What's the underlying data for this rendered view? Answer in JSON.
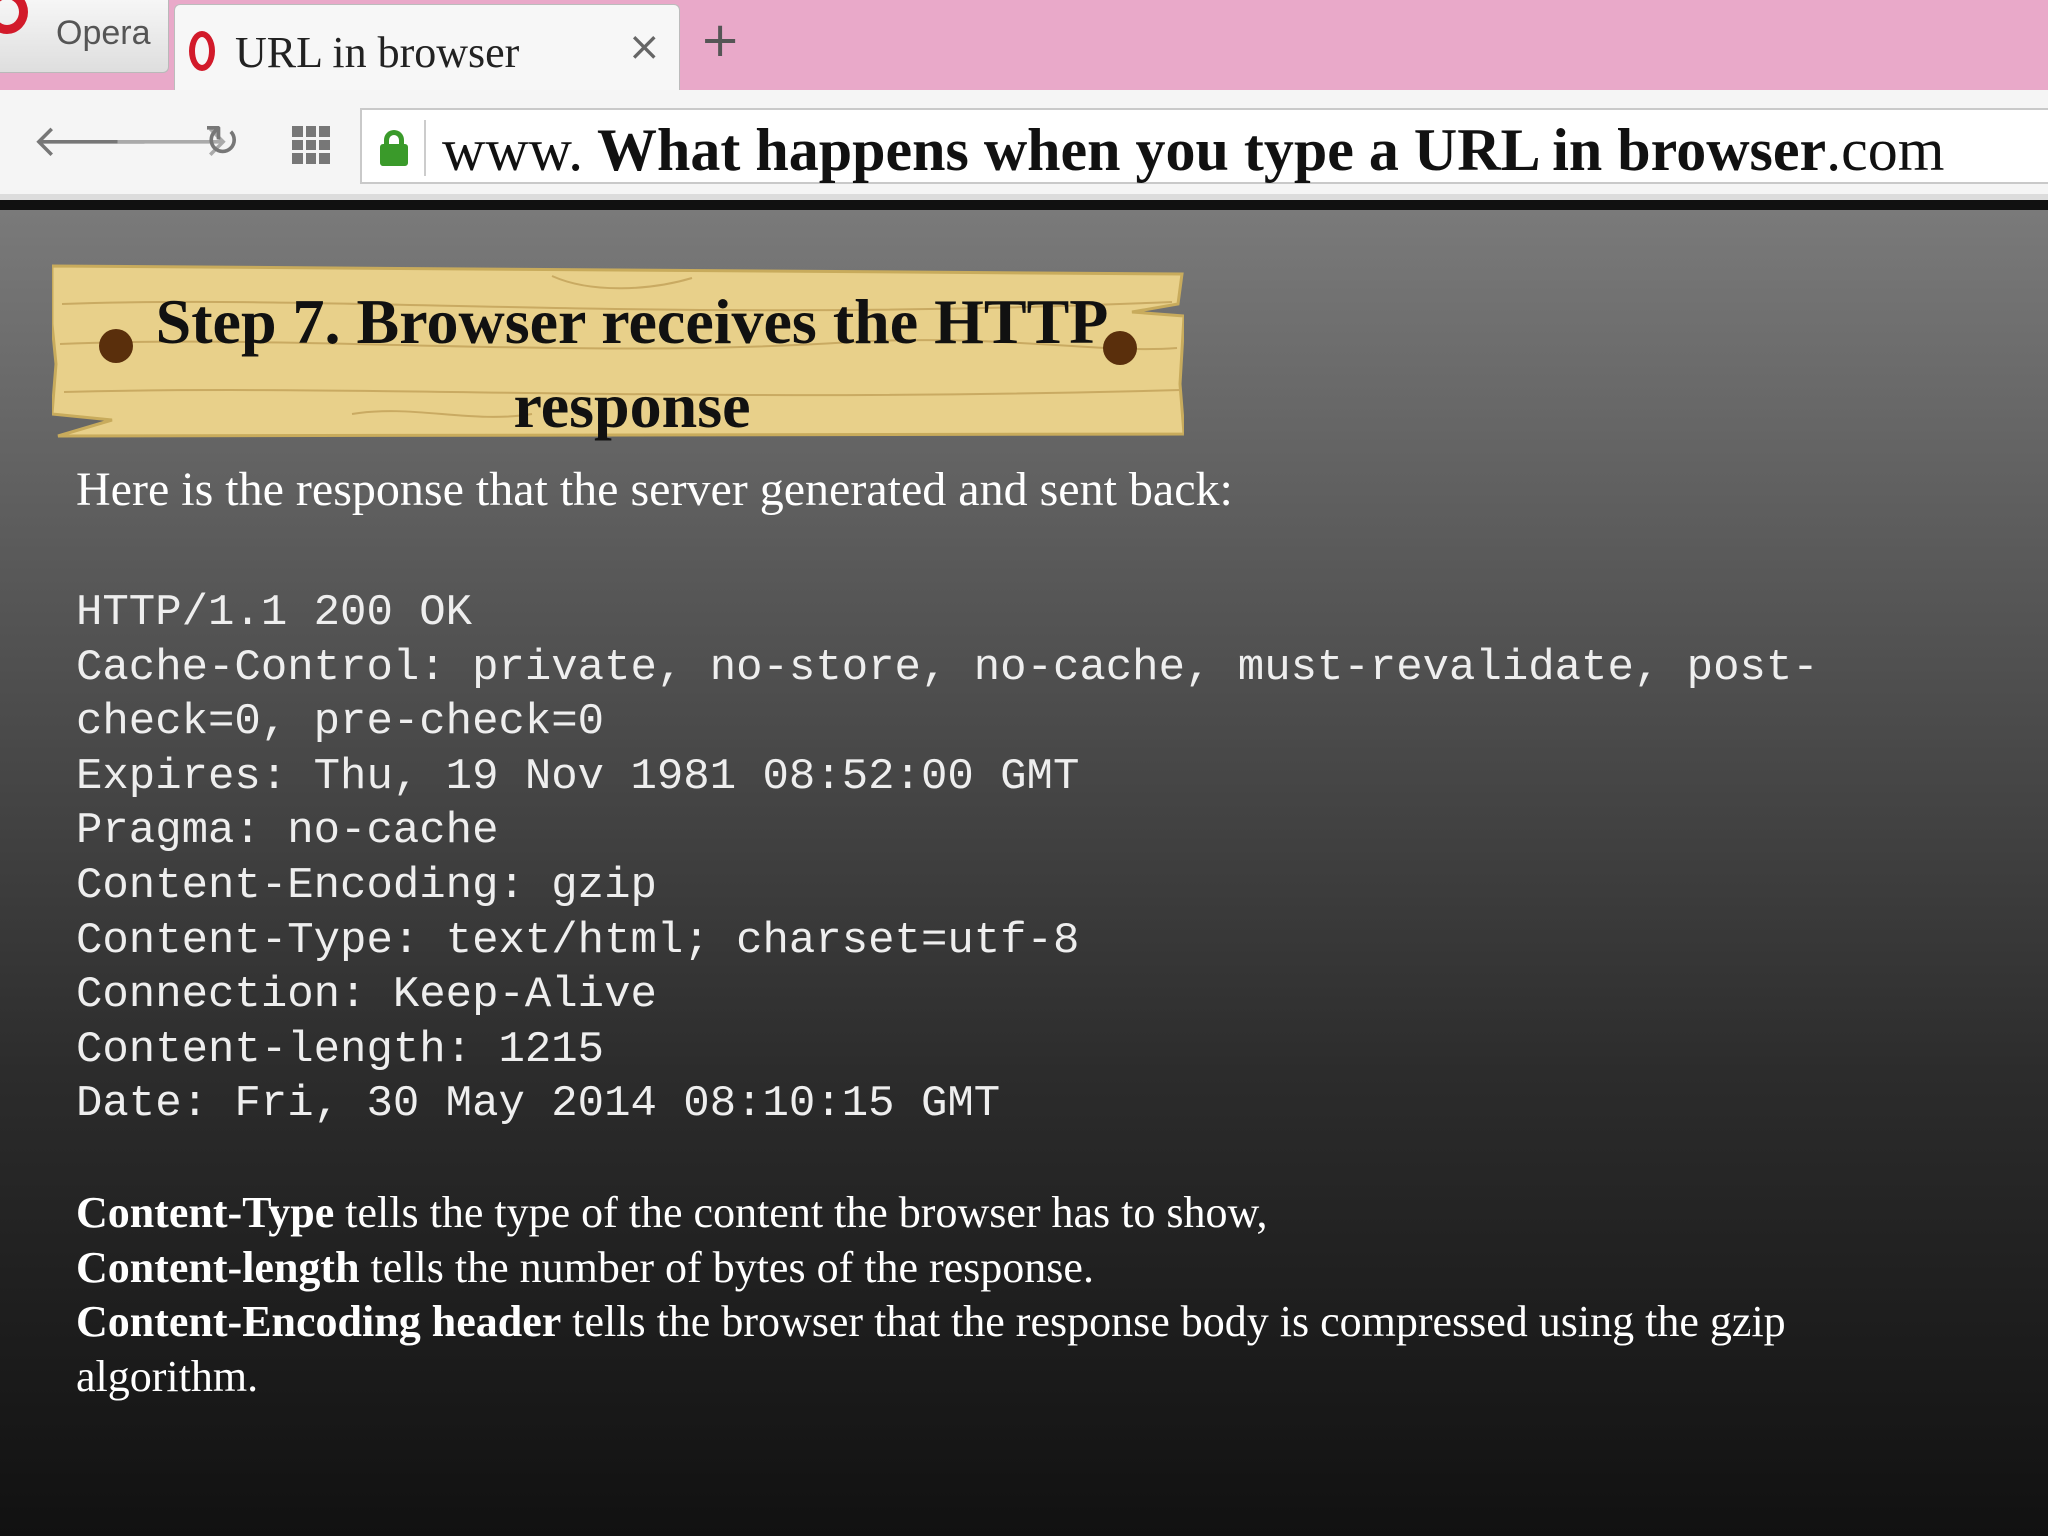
{
  "browser": {
    "menu_label": "Opera",
    "tab_title": "URL in browser",
    "tab_close": "×",
    "new_tab": "+",
    "address": {
      "prefix": "www.",
      "bold": " What happens when you type a URL in browser",
      "suffix": ".com"
    }
  },
  "slide": {
    "title": "Step 7. Browser receives the HTTP response",
    "intro": "Here is the response that the server generated and sent back:",
    "http_lines": [
      "HTTP/1.1 200 OK",
      "Cache-Control: private, no-store, no-cache, must-revalidate, post-",
      "check=0, pre-check=0",
      "Expires: Thu, 19 Nov 1981 08:52:00 GMT",
      "Pragma: no-cache",
      "Content-Encoding: gzip",
      "Content-Type: text/html; charset=utf-8",
      "Connection: Keep-Alive",
      "Content-length: 1215",
      "Date: Fri, 30 May 2014 08:10:15 GMT"
    ],
    "explanations": [
      {
        "term": "Content-Type",
        "text": " tells the type of the content the browser has to show,"
      },
      {
        "term": "Content-length",
        "text": " tells the number of bytes of the response."
      },
      {
        "term": "Content-Encoding header",
        "text": " tells the browser that the response body is compressed using the gzip algorithm."
      }
    ]
  },
  "colors": {
    "tabstrip": "#e9a9c9",
    "opera_red": "#d21a2a",
    "lock_green": "#3a9a2a",
    "plank": "#e8d08a"
  }
}
